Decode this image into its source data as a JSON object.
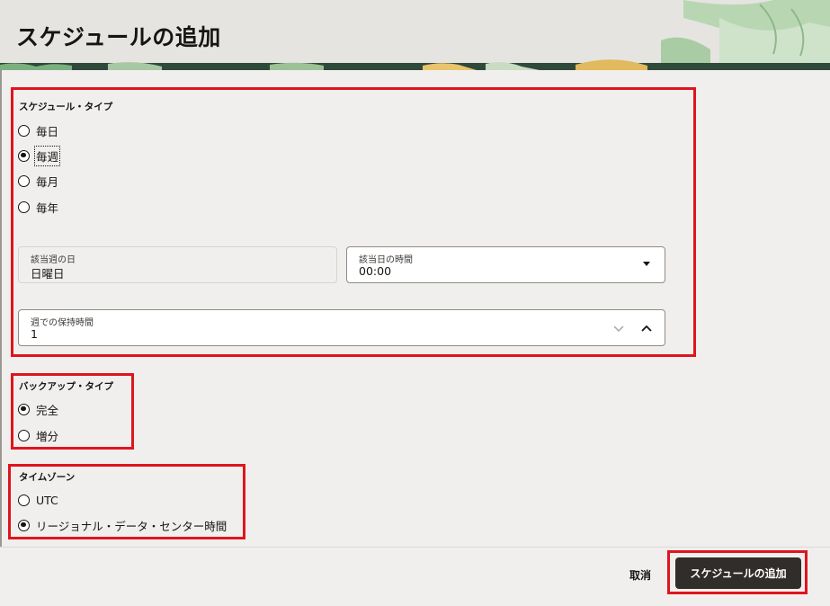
{
  "dialog": {
    "title": "スケジュールの追加"
  },
  "schedule_type": {
    "label": "スケジュール・タイプ",
    "options": [
      {
        "label": "毎日",
        "checked": false
      },
      {
        "label": "毎週",
        "checked": true
      },
      {
        "label": "毎月",
        "checked": false
      },
      {
        "label": "毎年",
        "checked": false
      }
    ]
  },
  "day_of_week": {
    "label": "該当週の日",
    "value": "日曜日"
  },
  "time_of_day": {
    "label": "該当日の時間",
    "value": "00:00"
  },
  "retention": {
    "label": "週での保持時間",
    "value": "1"
  },
  "backup_type": {
    "label": "バックアップ・タイプ",
    "options": [
      {
        "label": "完全",
        "checked": true
      },
      {
        "label": "増分",
        "checked": false
      }
    ]
  },
  "timezone": {
    "label": "タイムゾーン",
    "options": [
      {
        "label": "UTC",
        "checked": false
      },
      {
        "label": "リージョナル・データ・センター時間",
        "checked": true
      }
    ]
  },
  "footer": {
    "cancel_label": "取消",
    "submit_label": "スケジュールの追加"
  },
  "colors": {
    "highlight": "#e0141e",
    "primary_button": "#312d2a",
    "header_bg": "#e6e4e1"
  }
}
